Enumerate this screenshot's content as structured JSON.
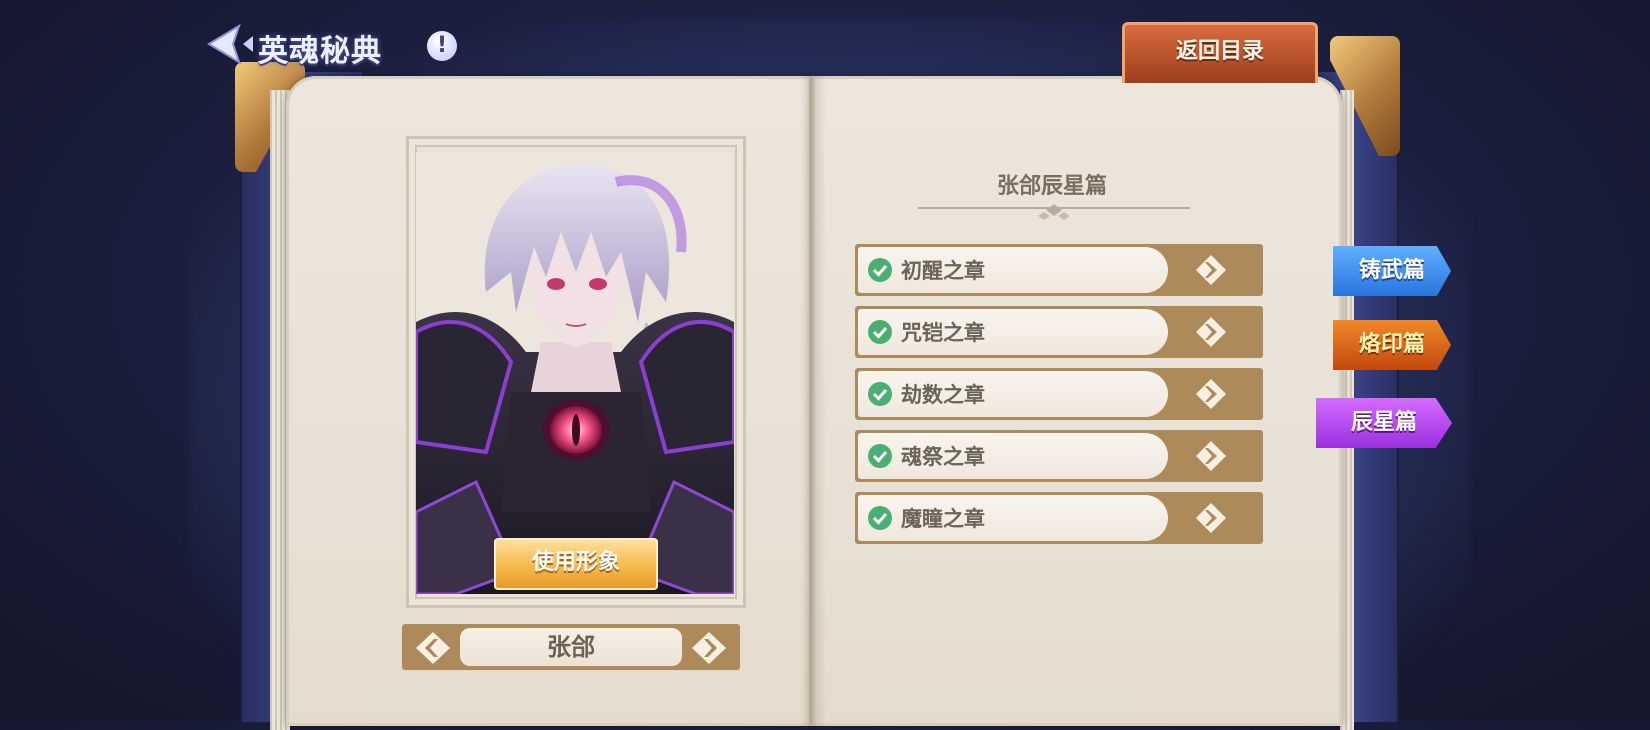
{
  "header": {
    "title": "英魂秘典",
    "info_icon": "!",
    "return_label": "返回目录"
  },
  "hero": {
    "use_image_label": "使用形象",
    "name": "张郃"
  },
  "chapter_section": {
    "title": "张郃辰星篇",
    "chapters": [
      {
        "label": "初醒之章",
        "completed": true
      },
      {
        "label": "咒铠之章",
        "completed": true
      },
      {
        "label": "劫数之章",
        "completed": true
      },
      {
        "label": "魂祭之章",
        "completed": true
      },
      {
        "label": "魔瞳之章",
        "completed": true
      }
    ]
  },
  "side_tabs": [
    {
      "label": "铸武篇",
      "color": "#2a74de"
    },
    {
      "label": "烙印篇",
      "color": "#c2480c"
    },
    {
      "label": "辰星篇",
      "color": "#9b2fe0",
      "active": true
    }
  ],
  "icons": {
    "back": "back-arrow-icon",
    "info": "info-icon",
    "check": "check-circle-icon",
    "chapter_go": "diamond-arrow-icon",
    "prev": "prev-arrow-icon",
    "next": "next-arrow-icon"
  },
  "colors": {
    "accent_brown": "#ad8a5a",
    "page": "#ece6dc",
    "check_green": "#4caf72"
  }
}
